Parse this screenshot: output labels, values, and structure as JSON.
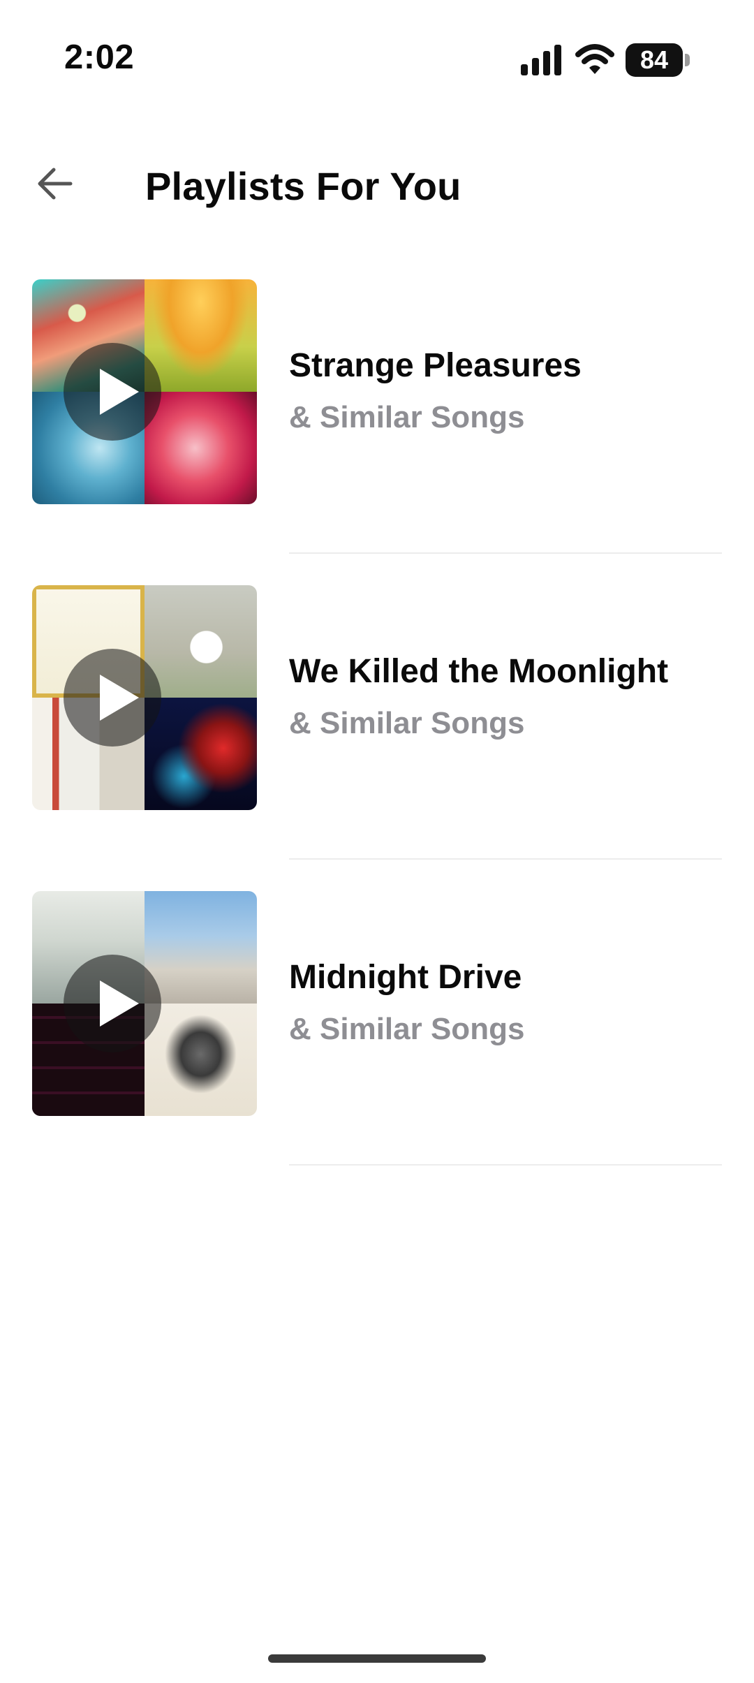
{
  "status_bar": {
    "time": "2:02",
    "battery_level": "84",
    "icons": [
      "signal-icon",
      "wifi-icon",
      "battery-icon"
    ]
  },
  "header": {
    "title": "Playlists For You",
    "back_icon": "arrow-left-icon"
  },
  "playlists": [
    {
      "title": "Strange Pleasures",
      "subtitle": "& Similar Songs"
    },
    {
      "title": "We Killed the Moonlight",
      "subtitle": "& Similar Songs"
    },
    {
      "title": "Midnight Drive",
      "subtitle": "& Similar Songs"
    }
  ],
  "colors": {
    "background": "#ffffff",
    "title_text": "#0a0a0a",
    "subtitle_text": "#8e8e93",
    "divider": "#ececec",
    "play_overlay": "rgba(20,20,20,0.55)"
  }
}
